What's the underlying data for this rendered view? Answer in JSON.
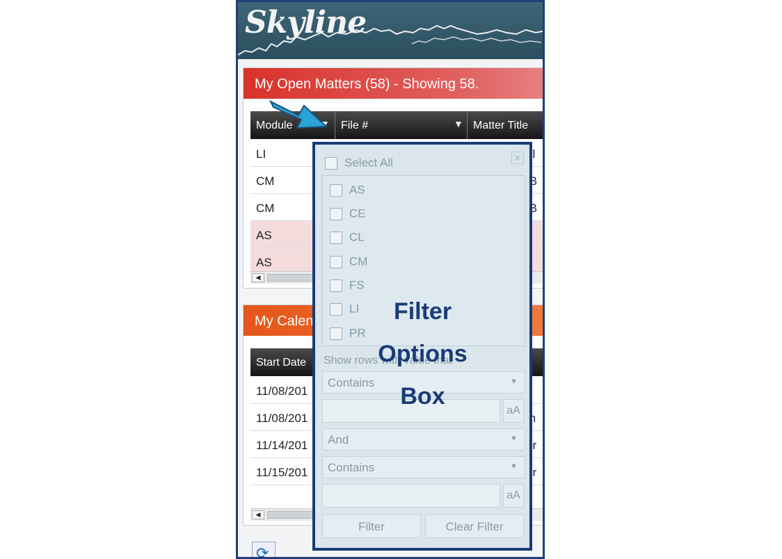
{
  "app": {
    "logo_text": "Skyline"
  },
  "open_matters": {
    "title": "My Open Matters (58) - Showing 58.",
    "columns": [
      "Module",
      "File #",
      "Matter Title"
    ],
    "rows": [
      {
        "module": "LI",
        "tail": "al"
      },
      {
        "module": "CM",
        "tail": ".B"
      },
      {
        "module": "CM",
        "tail": ".B"
      },
      {
        "module": "AS",
        "tail": ""
      },
      {
        "module": "AS",
        "tail": ""
      }
    ]
  },
  "calendar": {
    "title": "My Calen",
    "columns": [
      "Start Date"
    ],
    "rows": [
      {
        "date": "11/08/201",
        "tail": ""
      },
      {
        "date": "11/08/201",
        "tail": "m"
      },
      {
        "date": "11/14/201",
        "tail": "or"
      },
      {
        "date": "11/15/201",
        "tail": "or"
      }
    ]
  },
  "filter_box": {
    "select_all_label": "Select All",
    "close_label": "×",
    "options": [
      "AS",
      "CE",
      "CL",
      "CM",
      "FS",
      "LI",
      "PR"
    ],
    "show_rows_label": "Show rows with value that",
    "operator1": "Contains",
    "join": "And",
    "operator2": "Contains",
    "case_label": "aA",
    "filter_button": "Filter",
    "clear_button": "Clear Filter"
  },
  "caption": {
    "line1": "Filter",
    "line2": "Options",
    "line3": "Box"
  },
  "colors": {
    "frame": "#1f3f7a",
    "matters_header": "#d9322a",
    "calendar_header": "#e5561a",
    "arrow": "#2aa3d8"
  },
  "icons": {
    "filter": "funnel-icon",
    "refresh": "refresh-icon",
    "pointer": "arrow-pointer"
  }
}
